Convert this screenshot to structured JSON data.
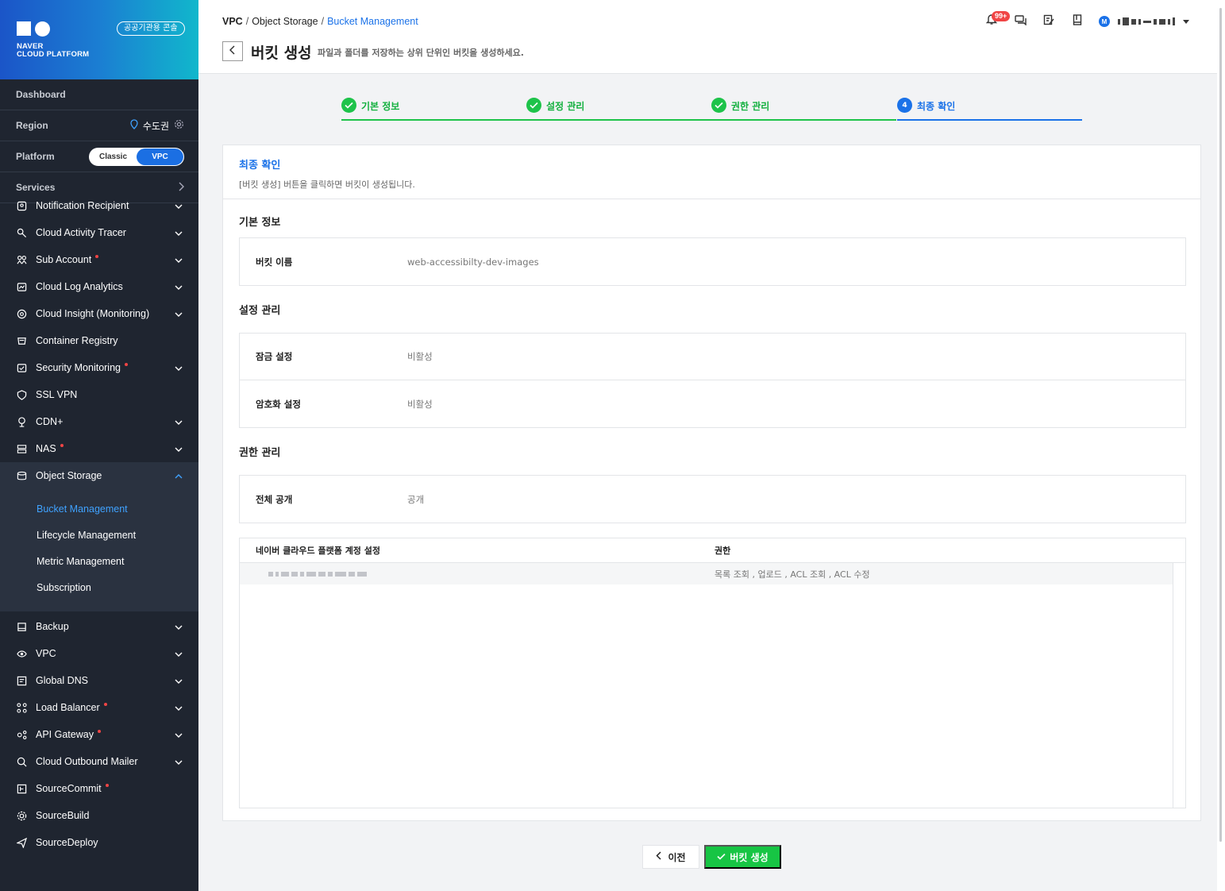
{
  "brand": {
    "logo_line1": "NAVER",
    "logo_line2": "CLOUD PLATFORM",
    "gov_badge": "공공기관용 콘솔"
  },
  "sidebar": {
    "dashboard": "Dashboard",
    "region_label": "Region",
    "region_value": "수도권",
    "platform_label": "Platform",
    "platform_options": [
      "Classic",
      "VPC"
    ],
    "platform_selected": "VPC",
    "services_label": "Services",
    "items": [
      {
        "label": "Notification Recipient",
        "icon": "notification-icon",
        "dot": false,
        "chevron": true
      },
      {
        "label": "Cloud Activity Tracer",
        "icon": "tracer-icon",
        "dot": false,
        "chevron": true
      },
      {
        "label": "Sub Account",
        "icon": "sub-account-icon",
        "dot": true,
        "chevron": true
      },
      {
        "label": "Cloud Log Analytics",
        "icon": "log-icon",
        "dot": false,
        "chevron": true
      },
      {
        "label": "Cloud Insight (Monitoring)",
        "icon": "insight-icon",
        "dot": false,
        "chevron": true
      },
      {
        "label": "Container Registry",
        "icon": "registry-icon",
        "dot": false,
        "chevron": false
      },
      {
        "label": "Security Monitoring",
        "icon": "security-icon",
        "dot": true,
        "chevron": true
      },
      {
        "label": "SSL VPN",
        "icon": "vpn-icon",
        "dot": false,
        "chevron": false
      },
      {
        "label": "CDN+",
        "icon": "cdn-icon",
        "dot": false,
        "chevron": true
      },
      {
        "label": "NAS",
        "icon": "nas-icon",
        "dot": true,
        "chevron": true
      },
      {
        "label": "Object Storage",
        "icon": "object-storage-icon",
        "dot": false,
        "chevron": true
      }
    ],
    "object_storage_sub": [
      "Bucket Management",
      "Lifecycle Management",
      "Metric Management",
      "Subscription"
    ],
    "items_after": [
      {
        "label": "Backup",
        "icon": "backup-icon",
        "dot": false,
        "chevron": true
      },
      {
        "label": "VPC",
        "icon": "vpc-icon",
        "dot": false,
        "chevron": true
      },
      {
        "label": "Global DNS",
        "icon": "dns-icon",
        "dot": false,
        "chevron": true
      },
      {
        "label": "Load Balancer",
        "icon": "load-balancer-icon",
        "dot": true,
        "chevron": true
      },
      {
        "label": "API Gateway",
        "icon": "api-gateway-icon",
        "dot": true,
        "chevron": true
      },
      {
        "label": "Cloud Outbound Mailer",
        "icon": "mailer-icon",
        "dot": false,
        "chevron": true
      },
      {
        "label": "SourceCommit",
        "icon": "source-commit-icon",
        "dot": true,
        "chevron": false
      },
      {
        "label": "SourceBuild",
        "icon": "source-build-icon",
        "dot": false,
        "chevron": false
      },
      {
        "label": "SourceDeploy",
        "icon": "source-deploy-icon",
        "dot": false,
        "chevron": false
      }
    ]
  },
  "header": {
    "breadcrumb": [
      "VPC",
      "Object Storage",
      "Bucket Management"
    ],
    "title": "버킷 생성",
    "description": "파일과 폴더를 저장하는 상위 단위인 버킷을 생성하세요.",
    "notification_count": "99+",
    "user_avatar": "M"
  },
  "steps": [
    {
      "label": "기본 정보",
      "state": "done"
    },
    {
      "label": "설정 관리",
      "state": "done"
    },
    {
      "label": "권한 관리",
      "state": "done"
    },
    {
      "label": "최종 확인",
      "state": "current",
      "number": "4"
    }
  ],
  "panel": {
    "title": "최종 확인",
    "description": "[버킷 생성] 버튼을 클릭하면 버킷이 생성됩니다.",
    "basic": {
      "title": "기본 정보",
      "rows": [
        {
          "key": "버킷 이름",
          "value": "web-accessibilty-dev-images"
        }
      ]
    },
    "settings": {
      "title": "설정 관리",
      "rows": [
        {
          "key": "잠금 설정",
          "value": "비활성"
        },
        {
          "key": "암호화 설정",
          "value": "비활성"
        }
      ]
    },
    "permissions": {
      "title": "권한 관리",
      "rows": [
        {
          "key": "전체 공개",
          "value": "공개"
        }
      ],
      "table_headers": [
        "네이버 클라우드 플랫폼 계정 설정",
        "권한"
      ],
      "table_rows": [
        {
          "permission": "목록 조회 , 업로드 , ACL 조회 , ACL 수정"
        }
      ]
    }
  },
  "buttons": {
    "prev": "이전",
    "create": "버킷 생성"
  },
  "colors": {
    "accent_blue": "#1b72e8",
    "success_green": "#17c544",
    "sidebar_bg": "#1f2530",
    "alert_red": "#f04545"
  }
}
